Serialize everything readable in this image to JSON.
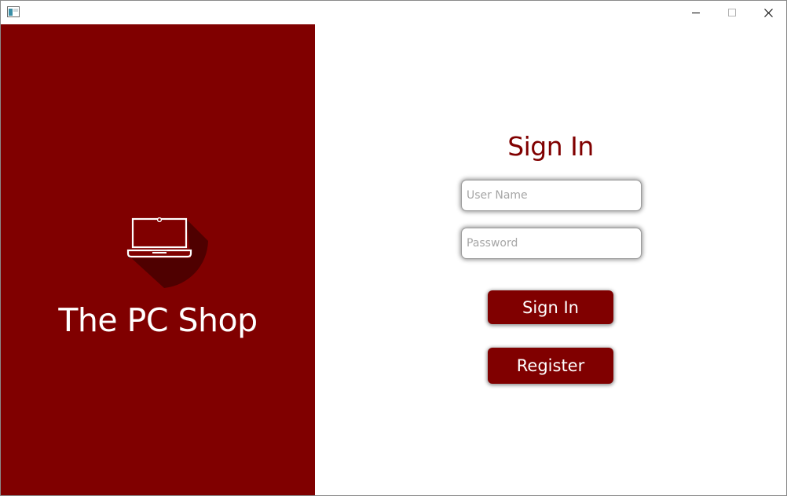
{
  "window": {
    "caption_buttons": {
      "minimize_icon": "minimize-icon",
      "maximize_icon": "maximize-icon",
      "close_icon": "close-icon"
    }
  },
  "colors": {
    "brand": "#800000",
    "logo_shadow": "#4f0000",
    "text_on_brand": "#ffffff",
    "placeholder": "#a6a6a6"
  },
  "left_panel": {
    "logo_icon": "laptop-icon",
    "brand_name": "The PC Shop"
  },
  "signin": {
    "title": "Sign In",
    "username": {
      "value": "",
      "placeholder": "User Name"
    },
    "password": {
      "value": "",
      "placeholder": "Password"
    },
    "signin_button": "Sign In",
    "register_button": "Register"
  }
}
